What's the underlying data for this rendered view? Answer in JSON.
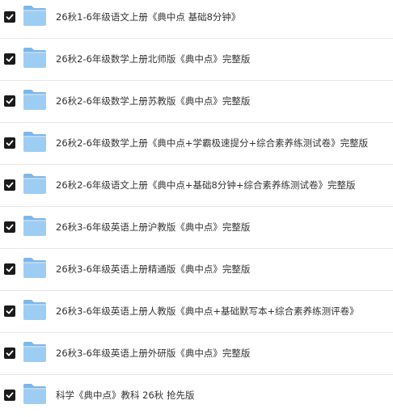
{
  "colors": {
    "checkbox_fill": "#1b1b1b",
    "checkmark": "#ffffff",
    "folder_front": "#9ecdf3",
    "folder_back": "#7db7ea",
    "text": "#333333",
    "divider": "#e6e6e6"
  },
  "icons": {
    "folder": "folder-icon",
    "checkbox": "checkbox-checked-icon"
  },
  "files": [
    {
      "name": "26秋1-6年级语文上册《典中点 基础8分钟》",
      "checked": true
    },
    {
      "name": "26秋2-6年级数学上册北师版《典中点》完整版",
      "checked": true
    },
    {
      "name": "26秋2-6年级数学上册苏教版《典中点》完整版",
      "checked": true
    },
    {
      "name": "26秋2-6年级数学上册《典中点+学霸极速提分+综合素养练测试卷》完整版",
      "checked": true
    },
    {
      "name": "26秋2-6年级语文上册《典中点+基础8分钟+综合素养练测试卷》完整版",
      "checked": true
    },
    {
      "name": "26秋3-6年级英语上册沪教版《典中点》完整版",
      "checked": true
    },
    {
      "name": "26秋3-6年级英语上册精通版《典中点》完整版",
      "checked": true
    },
    {
      "name": "26秋3-6年级英语上册人教版《典中点+基础默写本+综合素养练测评卷》",
      "checked": true
    },
    {
      "name": "26秋3-6年级英语上册外研版《典中点》完整版",
      "checked": true
    },
    {
      "name": "科学《典中点》教科 26秋 抢先版",
      "checked": true
    }
  ]
}
